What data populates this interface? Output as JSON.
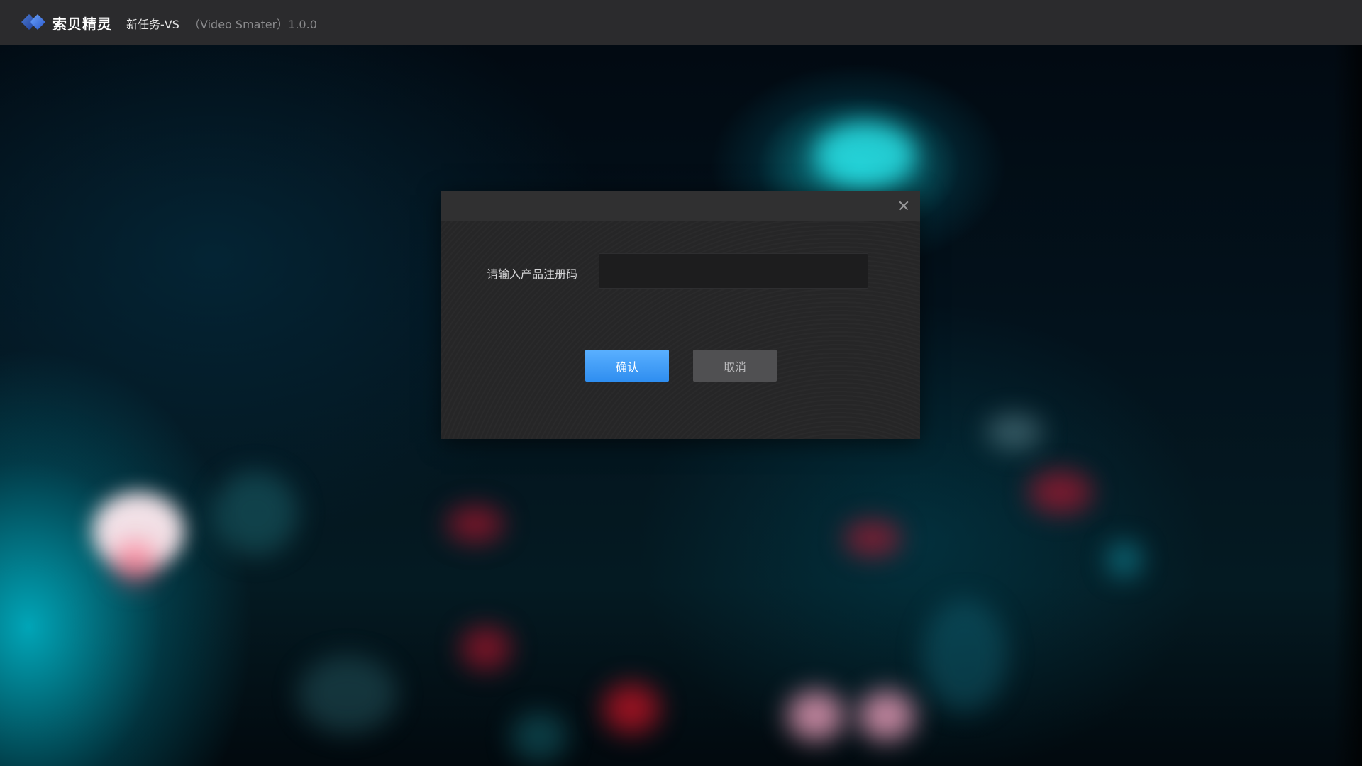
{
  "app": {
    "brand_name": "索贝精灵",
    "document_title": "新任务-VS",
    "app_name_version": "（Video Smater）1.0.0"
  },
  "dialog": {
    "field_label": "请输入产品注册码",
    "input_value": "",
    "input_placeholder": "",
    "confirm_label": "确认",
    "cancel_label": "取消"
  },
  "colors": {
    "accent": "#3a9bf8",
    "titlebar": "#2b2b2d",
    "dialog_bg": "#262627",
    "cancel_button": "#505052"
  },
  "icons": {
    "logo": "soben-diamond-logo",
    "close": "close-icon"
  }
}
